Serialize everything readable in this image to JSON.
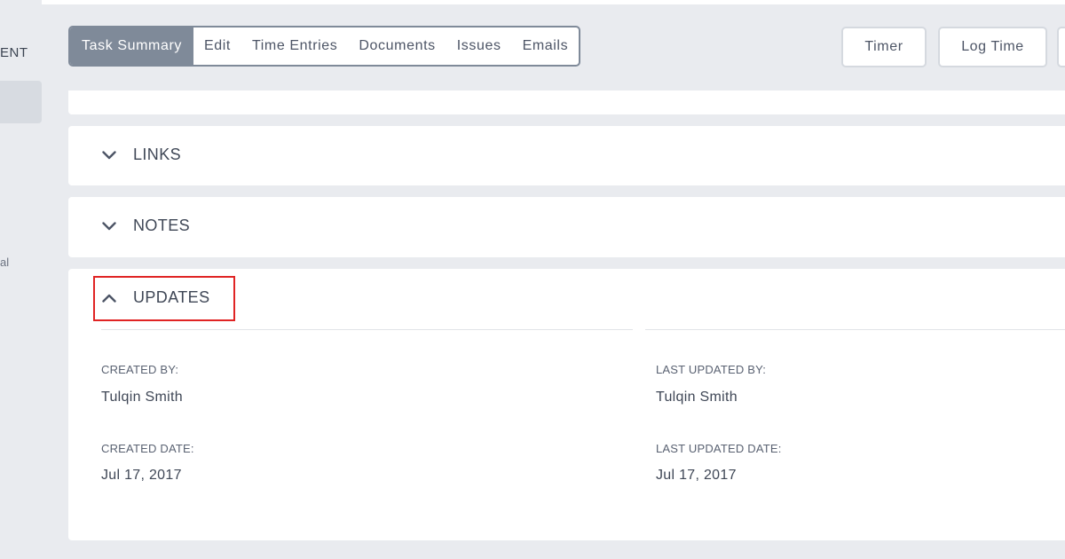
{
  "sidebar": {
    "title_fragment": "ENT",
    "item_fragment": "al"
  },
  "tabs": [
    {
      "label": "Task Summary",
      "active": true
    },
    {
      "label": "Edit",
      "active": false
    },
    {
      "label": "Time Entries",
      "active": false
    },
    {
      "label": "Documents",
      "active": false
    },
    {
      "label": "Issues",
      "active": false
    },
    {
      "label": "Emails",
      "active": false
    }
  ],
  "actions": {
    "timer_label": "Timer",
    "log_time_label": "Log Time"
  },
  "sections": {
    "links": {
      "title": "LINKS",
      "expanded": false
    },
    "notes": {
      "title": "NOTES",
      "expanded": false
    },
    "updates": {
      "title": "UPDATES",
      "expanded": true
    }
  },
  "updates": {
    "created_by_label": "CREATED BY:",
    "created_by_value": "Tulqin Smith",
    "last_updated_by_label": "LAST UPDATED BY:",
    "last_updated_by_value": "Tulqin Smith",
    "created_date_label": "CREATED DATE:",
    "created_date_value": "Jul 17, 2017",
    "last_updated_date_label": "LAST UPDATED DATE:",
    "last_updated_date_value": "Jul 17, 2017"
  },
  "colors": {
    "active_tab": "#7f8a99",
    "highlight": "#e02424",
    "background": "#e9ebef"
  },
  "icons": {
    "collapsed": "chevron-down-icon",
    "expanded": "chevron-up-icon"
  }
}
